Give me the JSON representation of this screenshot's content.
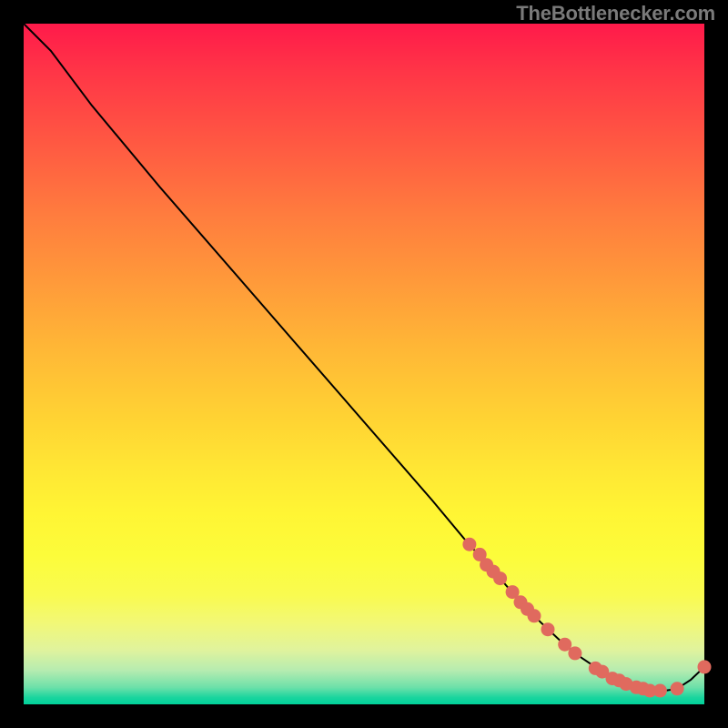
{
  "header": {
    "site_label": "TheBottlenecker.com"
  },
  "colors": {
    "page_bg": "#000000",
    "header_text": "#7a7a7a",
    "curve": "#000000",
    "dot_fill": "#e06a5e"
  },
  "chart_data": {
    "type": "line",
    "title": "",
    "xlabel": "",
    "ylabel": "",
    "xlim": [
      0,
      100
    ],
    "ylim": [
      0,
      100
    ],
    "grid": false,
    "legend": false,
    "series": [
      {
        "name": "bottleneck-curve",
        "x": [
          0,
          4,
          10,
          20,
          30,
          40,
          50,
          60,
          65,
          70,
          73,
          76,
          79,
          82,
          85,
          88,
          91,
          93.5,
          96,
          98,
          100
        ],
        "y": [
          100,
          96,
          88,
          76,
          64.5,
          53,
          41.5,
          30,
          24,
          18.5,
          15,
          12,
          9.2,
          6.8,
          4.8,
          3.3,
          2.3,
          1.9,
          2.3,
          3.6,
          5.5
        ]
      }
    ],
    "points": [
      {
        "name": "p1",
        "x": 65.5,
        "y": 23.5
      },
      {
        "name": "p2",
        "x": 67.0,
        "y": 22.0
      },
      {
        "name": "p3",
        "x": 68.0,
        "y": 20.5
      },
      {
        "name": "p4",
        "x": 69.0,
        "y": 19.5
      },
      {
        "name": "p5",
        "x": 70.0,
        "y": 18.5
      },
      {
        "name": "p6",
        "x": 71.8,
        "y": 16.5
      },
      {
        "name": "p7",
        "x": 73.0,
        "y": 15.0
      },
      {
        "name": "p8",
        "x": 74.0,
        "y": 14.0
      },
      {
        "name": "p9",
        "x": 75.0,
        "y": 13.0
      },
      {
        "name": "p10",
        "x": 77.0,
        "y": 11.0
      },
      {
        "name": "p11",
        "x": 79.5,
        "y": 8.8
      },
      {
        "name": "p12",
        "x": 81.0,
        "y": 7.5
      },
      {
        "name": "p13",
        "x": 84.0,
        "y": 5.3
      },
      {
        "name": "p14",
        "x": 85.0,
        "y": 4.8
      },
      {
        "name": "p15",
        "x": 86.5,
        "y": 3.8
      },
      {
        "name": "p16",
        "x": 87.5,
        "y": 3.5
      },
      {
        "name": "p17",
        "x": 88.5,
        "y": 3.0
      },
      {
        "name": "p18",
        "x": 90.0,
        "y": 2.5
      },
      {
        "name": "p19",
        "x": 91.0,
        "y": 2.3
      },
      {
        "name": "p20",
        "x": 92.0,
        "y": 2.0
      },
      {
        "name": "p21",
        "x": 93.5,
        "y": 2.0
      },
      {
        "name": "p22",
        "x": 96.0,
        "y": 2.3
      },
      {
        "name": "p23",
        "x": 100.0,
        "y": 5.5
      }
    ]
  }
}
